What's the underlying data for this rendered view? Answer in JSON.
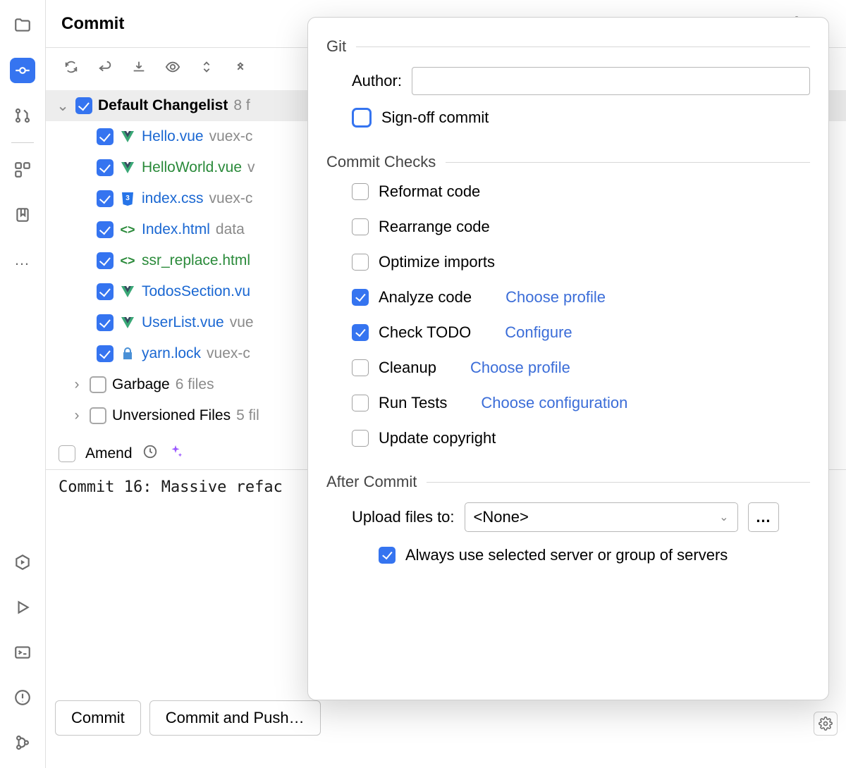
{
  "title": "Commit",
  "tree": {
    "default_changelist": "Default Changelist",
    "default_changelist_hint": "8 f",
    "files": [
      {
        "name": "Hello.vue",
        "hint": "vuex-c",
        "icon": "vue",
        "color": "blue"
      },
      {
        "name": "HelloWorld.vue",
        "hint": "v",
        "icon": "vue",
        "color": "green"
      },
      {
        "name": "index.css",
        "hint": "vuex-c",
        "icon": "css",
        "color": "blue"
      },
      {
        "name": "Index.html",
        "hint": "data",
        "icon": "html",
        "color": "blue"
      },
      {
        "name": "ssr_replace.html",
        "hint": "",
        "icon": "html",
        "color": "green"
      },
      {
        "name": "TodosSection.vu",
        "hint": "",
        "icon": "vue",
        "color": "blue"
      },
      {
        "name": "UserList.vue",
        "hint": "vue",
        "icon": "vue",
        "color": "blue"
      },
      {
        "name": "yarn.lock",
        "hint": "vuex-c",
        "icon": "lock",
        "color": "blue"
      }
    ],
    "garbage_label": "Garbage",
    "garbage_hint": "6 files",
    "unversioned_label": "Unversioned Files",
    "unversioned_hint": "5 fil"
  },
  "amend_label": "Amend",
  "commit_message": "Commit 16: Massive refac",
  "buttons": {
    "commit": "Commit",
    "commit_push": "Commit and Push…"
  },
  "popup": {
    "git_section": "Git",
    "author_label": "Author:",
    "author_value": "",
    "signoff": "Sign-off commit",
    "checks_section": "Commit Checks",
    "checks": [
      {
        "label": "Reformat code",
        "checked": false,
        "link": ""
      },
      {
        "label": "Rearrange code",
        "checked": false,
        "link": ""
      },
      {
        "label": "Optimize imports",
        "checked": false,
        "link": ""
      },
      {
        "label": "Analyze code",
        "checked": true,
        "link": "Choose profile"
      },
      {
        "label": "Check TODO",
        "checked": true,
        "link": "Configure"
      },
      {
        "label": "Cleanup",
        "checked": false,
        "link": "Choose profile"
      },
      {
        "label": "Run Tests",
        "checked": false,
        "link": "Choose configuration"
      },
      {
        "label": "Update copyright",
        "checked": false,
        "link": ""
      }
    ],
    "after_section": "After Commit",
    "upload_label": "Upload files to:",
    "upload_value": "<None>",
    "dots": "…",
    "always_use": "Always use selected server or group of servers"
  }
}
